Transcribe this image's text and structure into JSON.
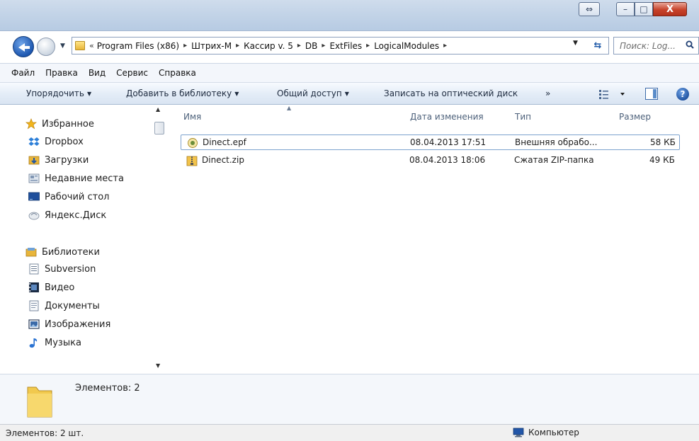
{
  "window": {
    "controls": {
      "resize": "⇔",
      "minimize": "–",
      "maximize": "□",
      "close": "X"
    }
  },
  "address": {
    "overflow": "«",
    "path": [
      "Program Files (x86)",
      "Штрих-М",
      "Кассир v. 5",
      "DB",
      "ExtFiles",
      "LogicalModules"
    ],
    "separator": "▸"
  },
  "search": {
    "placeholder": "Поиск: Log..."
  },
  "menu": [
    "Файл",
    "Правка",
    "Вид",
    "Сервис",
    "Справка"
  ],
  "toolbar": {
    "organize": "Упорядочить",
    "add_library": "Добавить в библиотеку",
    "share": "Общий доступ",
    "burn": "Записать на оптический диск",
    "more": "»"
  },
  "navigation": {
    "favorites": {
      "label": "Избранное",
      "items": [
        "Dropbox",
        "Загрузки",
        "Недавние места",
        "Рабочий стол",
        "Яндекс.Диск"
      ]
    },
    "libraries": {
      "label": "Библиотеки",
      "items": [
        "Subversion",
        "Видео",
        "Документы",
        "Изображения",
        "Музыка"
      ]
    }
  },
  "columns": {
    "name": "Имя",
    "date": "Дата изменения",
    "type": "Тип",
    "size": "Размер"
  },
  "files": [
    {
      "name": "Dinect.epf",
      "date": "08.04.2013 17:51",
      "type": "Внешняя обрабо...",
      "size": "58 КБ",
      "icon": "epf-file-icon",
      "selected": true
    },
    {
      "name": "Dinect.zip",
      "date": "08.04.2013 18:06",
      "type": "Сжатая ZIP-папка",
      "size": "49 КБ",
      "icon": "zip-folder-icon",
      "selected": false
    }
  ],
  "details_pane": {
    "summary": "Элементов: 2"
  },
  "status": {
    "left": "Элементов: 2 шт.",
    "right": "Компьютер"
  },
  "colors": {
    "accent": "#1d57b0",
    "folder": "#e8b53a",
    "selection_border": "#7da2ce"
  }
}
